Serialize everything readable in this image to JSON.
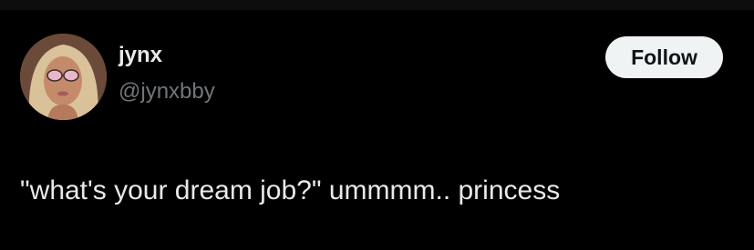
{
  "tweet": {
    "author": {
      "display_name": "jynx",
      "handle": "@jynxbby",
      "avatar_icon": "profile-photo"
    },
    "follow_label": "Follow",
    "text": "\"what's your dream job?\" ummmm.. princess"
  },
  "colors": {
    "background": "#000000",
    "primary_text": "#e7e9ea",
    "secondary_text": "#71767b",
    "follow_button_bg": "#eff3f4",
    "follow_button_text": "#0f1419"
  }
}
